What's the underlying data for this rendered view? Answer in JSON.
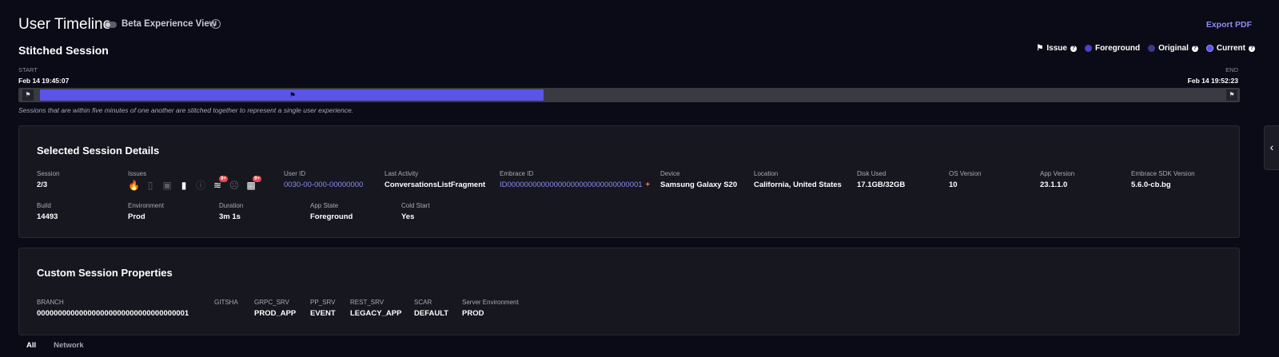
{
  "header": {
    "title": "User Timeline",
    "beta_label": "Beta Experience View",
    "info_glyph": "i",
    "export_label": "Export PDF"
  },
  "timeline": {
    "title": "Stitched Session",
    "legend": [
      {
        "label": "Issue",
        "kind": "flag"
      },
      {
        "label": "Foreground",
        "color": "#4b43c9"
      },
      {
        "label": "Original",
        "color": "#3a3a8a"
      },
      {
        "label": "Current",
        "color": "#5b54e8"
      }
    ],
    "start_label": "START",
    "start_time": "Feb 14 19:45:07",
    "end_label": "END",
    "end_time": "Feb 14 19:52:23",
    "note": "Sessions that are within five minutes of one another are stitched together to represent a single user experience."
  },
  "details": {
    "title": "Selected Session Details",
    "session": {
      "label": "Session",
      "value": "2/3"
    },
    "issues": {
      "label": "Issues",
      "icons": [
        {
          "name": "crash-icon",
          "glyph": "🔥",
          "active": false
        },
        {
          "name": "anr-icon",
          "glyph": "▯",
          "active": false
        },
        {
          "name": "memory-icon",
          "glyph": "▣",
          "active": false
        },
        {
          "name": "log-icon",
          "glyph": "▮",
          "active": true
        },
        {
          "name": "error-icon",
          "glyph": "ⓘ",
          "active": false
        },
        {
          "name": "network-icon",
          "glyph": "≋",
          "active": true,
          "badge": "9+"
        },
        {
          "name": "sad-face-icon",
          "glyph": "☹",
          "active": false
        },
        {
          "name": "cpu-icon",
          "glyph": "▩",
          "active": true,
          "badge": "9+"
        }
      ]
    },
    "user_id": {
      "label": "User ID",
      "value": "0030-00-000-00000000"
    },
    "last_activity": {
      "label": "Last Activity",
      "value": "ConversationsListFragment"
    },
    "embrace_id": {
      "label": "Embrace ID",
      "value": "ID00000000000000000000000000000001"
    },
    "device": {
      "label": "Device",
      "value": "Samsung Galaxy S20"
    },
    "location": {
      "label": "Location",
      "value": "California, United States"
    },
    "disk_used": {
      "label": "Disk Used",
      "value": "17.1GB/32GB"
    },
    "os_version": {
      "label": "OS Version",
      "value": "10"
    },
    "app_version": {
      "label": "App Version",
      "value": "23.1.1.0"
    },
    "sdk_version": {
      "label": "Embrace SDK Version",
      "value": "5.6.0-cb.bg"
    },
    "build": {
      "label": "Build",
      "value": "14493"
    },
    "environment": {
      "label": "Environment",
      "value": "Prod"
    },
    "duration": {
      "label": "Duration",
      "value": "3m 1s"
    },
    "app_state": {
      "label": "App State",
      "value": "Foreground"
    },
    "cold_start": {
      "label": "Cold Start",
      "value": "Yes"
    }
  },
  "custom": {
    "title": "Custom Session Properties",
    "props": [
      {
        "label": "BRANCH",
        "value": "000000000000000000000000000000000001"
      },
      {
        "label": "GITSHA",
        "value": ""
      },
      {
        "label": "GRPC_SRV",
        "value": "PROD_APP"
      },
      {
        "label": "PP_SRV",
        "value": "EVENT"
      },
      {
        "label": "REST_SRV",
        "value": "LEGACY_APP"
      },
      {
        "label": "SCAR",
        "value": "DEFAULT"
      },
      {
        "label": "Server Environment",
        "value": "PROD"
      }
    ]
  },
  "tabs": [
    {
      "label": "All",
      "active": true
    },
    {
      "label": "Network",
      "active": false
    }
  ]
}
